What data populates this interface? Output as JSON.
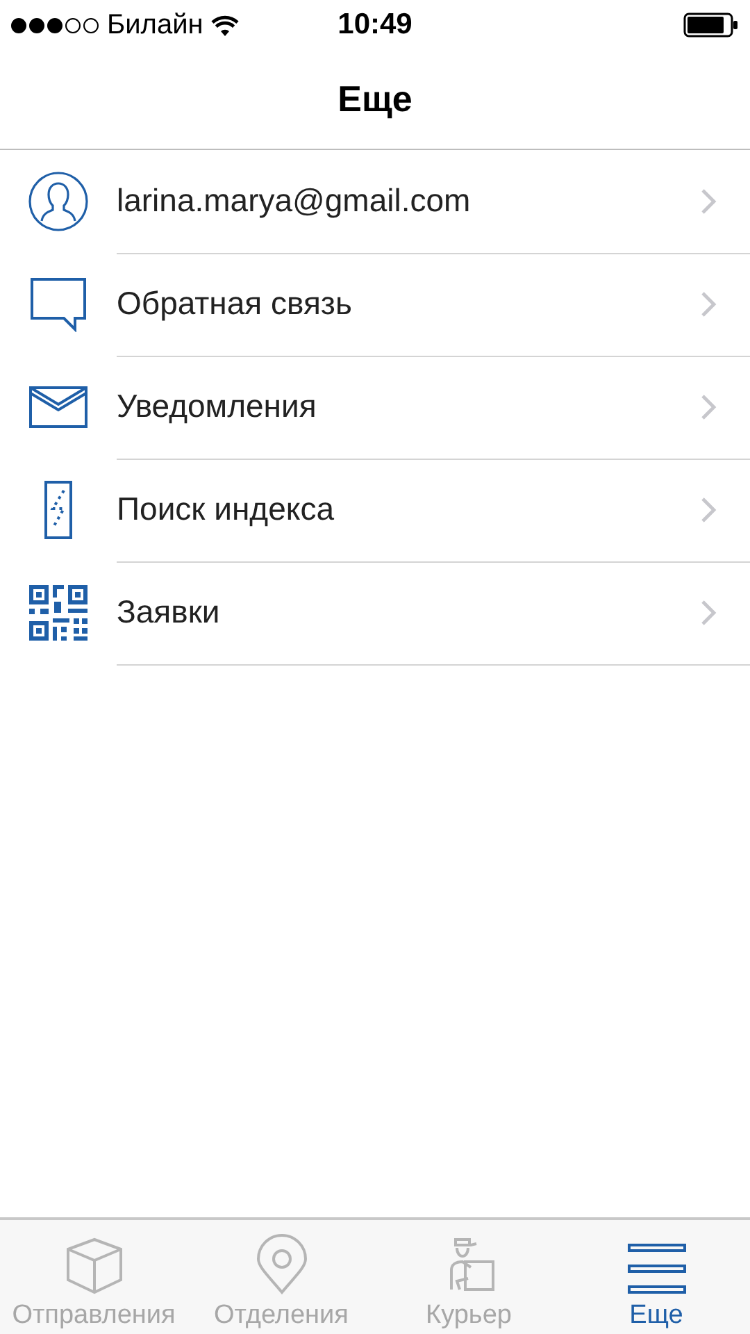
{
  "status_bar": {
    "signal_dots": [
      {
        "filled": true
      },
      {
        "filled": true
      },
      {
        "filled": true
      },
      {
        "filled": false
      },
      {
        "filled": false
      }
    ],
    "carrier": "Билайн",
    "time": "10:49"
  },
  "header": {
    "title": "Еще"
  },
  "menu": [
    {
      "kind": "profile",
      "label": "larina.marya@gmail.com"
    },
    {
      "kind": "feedback",
      "label": "Обратная связь"
    },
    {
      "kind": "notifications",
      "label": "Уведомления"
    },
    {
      "kind": "index",
      "label": "Поиск индекса"
    },
    {
      "kind": "requests",
      "label": "Заявки"
    }
  ],
  "tabs": [
    {
      "kind": "parcels",
      "label": "Отправления",
      "selected": false
    },
    {
      "kind": "offices",
      "label": "Отделения",
      "selected": false
    },
    {
      "kind": "courier",
      "label": "Курьер",
      "selected": false
    },
    {
      "kind": "more",
      "label": "Еще",
      "selected": true
    }
  ]
}
